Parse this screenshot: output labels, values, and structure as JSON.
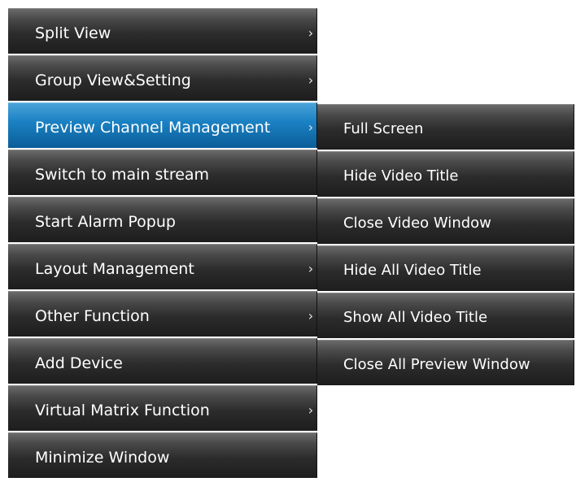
{
  "menu": {
    "items": [
      {
        "label": "Split View",
        "has_submenu": true
      },
      {
        "label": "Group View&Setting",
        "has_submenu": true
      },
      {
        "label": "Preview Channel Management",
        "has_submenu": true,
        "active": true
      },
      {
        "label": "Switch to main stream",
        "has_submenu": false
      },
      {
        "label": "Start Alarm Popup",
        "has_submenu": false
      },
      {
        "label": "Layout Management",
        "has_submenu": true
      },
      {
        "label": "Other Function",
        "has_submenu": true
      },
      {
        "label": "Add Device",
        "has_submenu": false
      },
      {
        "label": "Virtual Matrix Function",
        "has_submenu": true
      },
      {
        "label": "Minimize Window",
        "has_submenu": false
      }
    ]
  },
  "submenu": {
    "items": [
      {
        "label": "Full Screen"
      },
      {
        "label": "Hide Video Title"
      },
      {
        "label": "Close Video Window"
      },
      {
        "label": "Hide All Video Title"
      },
      {
        "label": "Show All Video Title"
      },
      {
        "label": "Close All Preview Window"
      }
    ]
  },
  "icons": {
    "submenu_arrow": "chevron-right-icon",
    "arrow_glyph": "›"
  },
  "colors": {
    "item_background": "#2c2c2c",
    "active_background": "#1b82c4",
    "text": "#ffffff"
  }
}
